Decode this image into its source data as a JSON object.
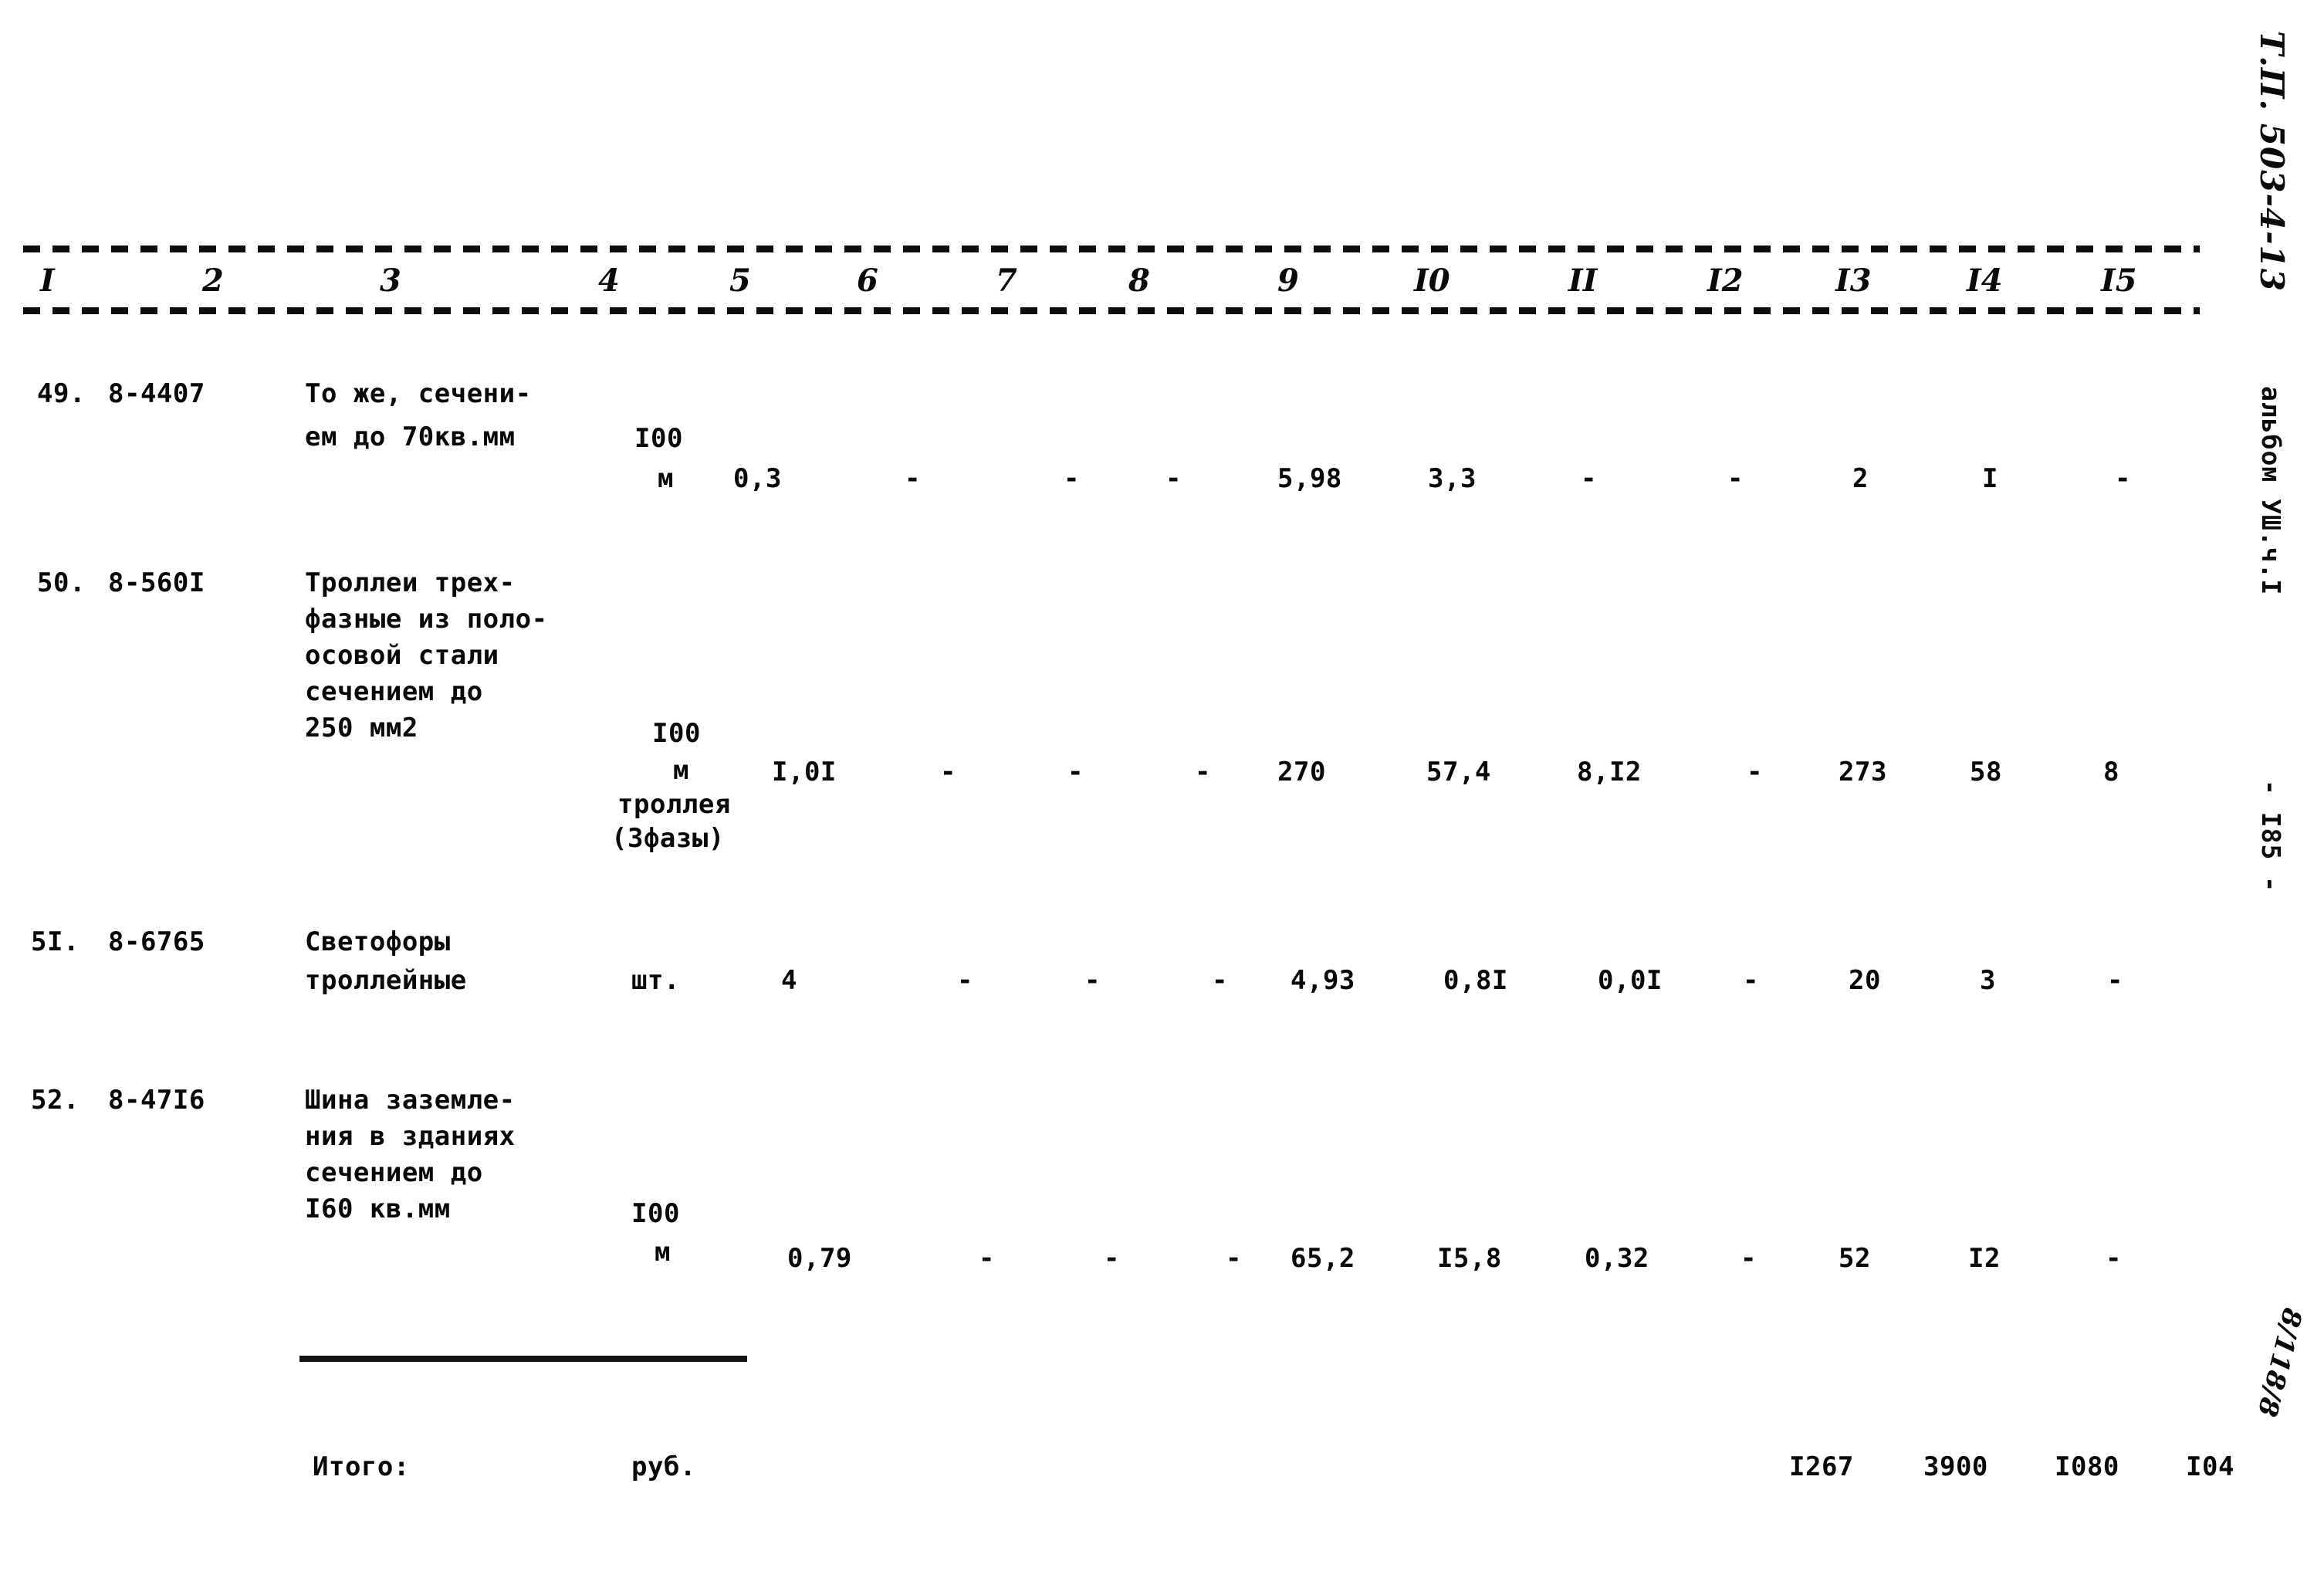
{
  "document": {
    "side_caption_code": "Т.П. 503-4-13",
    "side_caption_album": "альбом УШ.ч.I",
    "side_page_number": "- I85 -",
    "side_handwritten_mark": "8/118/8"
  },
  "table": {
    "column_numbers": [
      "I",
      "2",
      "3",
      "4",
      "5",
      "6",
      "7",
      "8",
      "9",
      "I0",
      "II",
      "I2",
      "I3",
      "I4",
      "I5"
    ],
    "rows": [
      {
        "index": "49.",
        "code": "8-4407",
        "description_lines": [
          "То же, сечени-",
          "ем до 70кв.мм"
        ],
        "unit_lines": [
          "I00",
          "м"
        ],
        "values": [
          "0,3",
          "-",
          "-",
          "-",
          "5,98",
          "3,3",
          "-",
          "-",
          "2",
          "I",
          "-"
        ]
      },
      {
        "index": "50.",
        "code": "8-560I",
        "description_lines": [
          "Троллеи трех-",
          "фазные из поло-",
          "осовой стали",
          "сечением до",
          "250 мм2"
        ],
        "unit_lines": [
          "I00",
          "м",
          "троллея",
          "(3фазы)"
        ],
        "values": [
          "I,0I",
          "-",
          "-",
          "-",
          "270",
          "57,4",
          "8,I2",
          "-",
          "273",
          "58",
          "8"
        ]
      },
      {
        "index": "5I.",
        "code": "8-6765",
        "description_lines": [
          "Светофоры",
          "троллейные"
        ],
        "unit_lines": [
          "шт."
        ],
        "values": [
          "4",
          "-",
          "-",
          "-",
          "4,93",
          "0,8I",
          "0,0I",
          "-",
          "20",
          "3",
          "-"
        ]
      },
      {
        "index": "52.",
        "code": "8-47I6",
        "description_lines": [
          "Шина заземле-",
          "ния в зданиях",
          "сечением до",
          "I60 кв.мм"
        ],
        "unit_lines": [
          "I00",
          "м"
        ],
        "values": [
          "0,79",
          "-",
          "-",
          "-",
          "65,2",
          "I5,8",
          "0,32",
          "-",
          "52",
          "I2",
          "-"
        ]
      }
    ],
    "total": {
      "label": "Итого:",
      "unit": "руб.",
      "values": [
        "I267",
        "3900",
        "I080",
        "I04"
      ]
    }
  }
}
